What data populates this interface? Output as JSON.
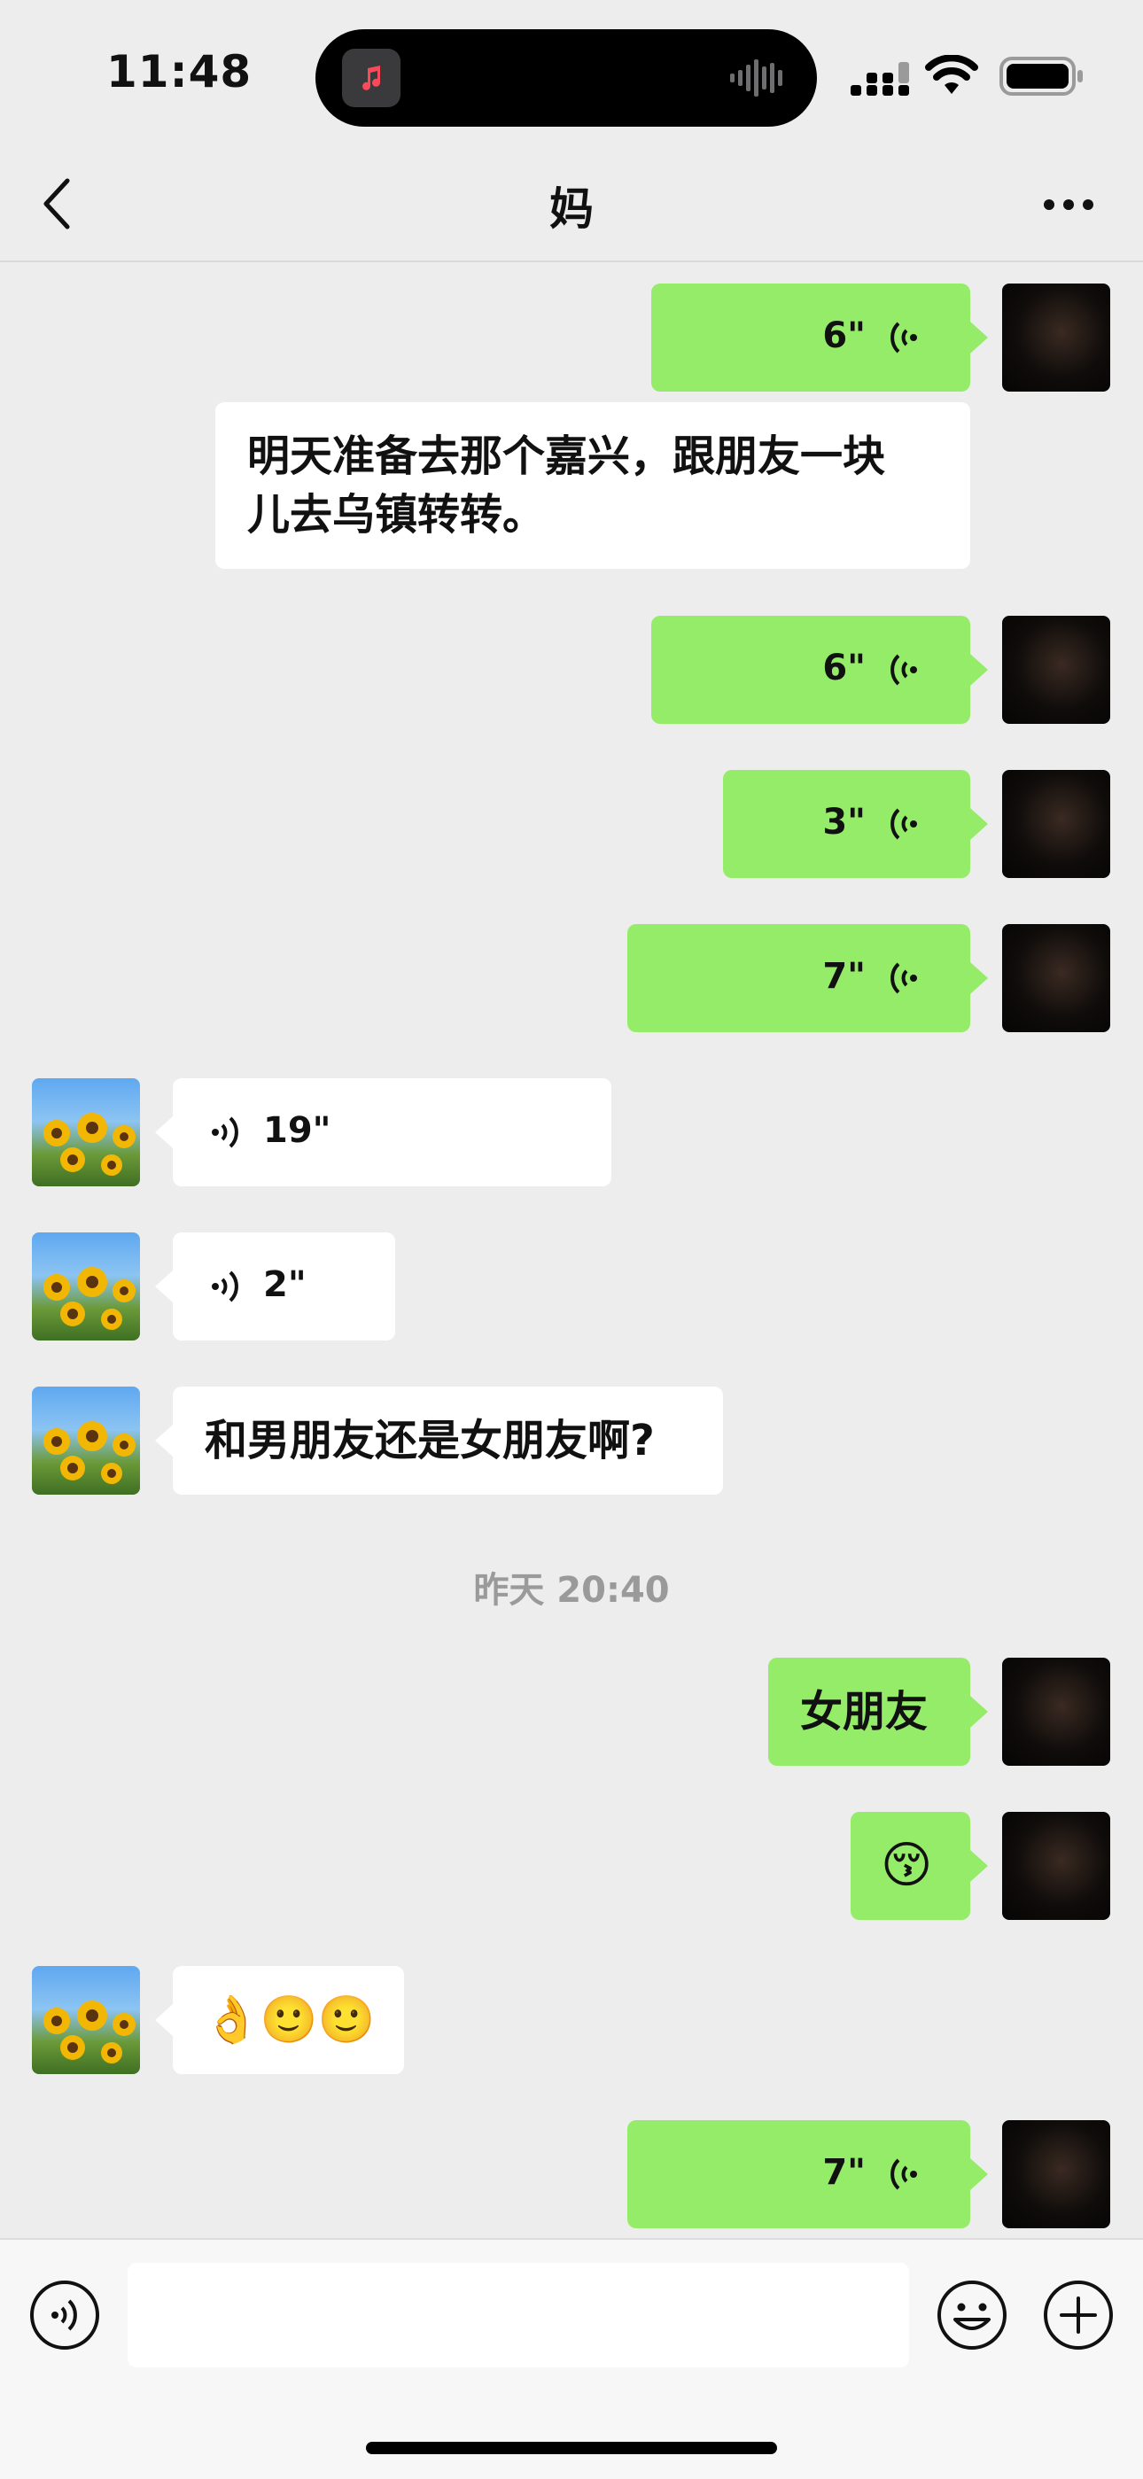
{
  "status_bar": {
    "time": "11:48"
  },
  "header": {
    "title": "妈"
  },
  "messages": [
    {
      "side": "out",
      "type": "voice",
      "duration": "6\""
    },
    {
      "side": "in_noavatar",
      "type": "text",
      "line1": "明天准备去那个嘉兴，跟朋友一块",
      "line2": "儿去乌镇转转。"
    },
    {
      "side": "out",
      "type": "voice",
      "duration": "6\""
    },
    {
      "side": "out",
      "type": "voice",
      "duration": "3\""
    },
    {
      "side": "out",
      "type": "voice",
      "duration": "7\""
    },
    {
      "side": "in",
      "type": "voice",
      "duration": "19\""
    },
    {
      "side": "in",
      "type": "voice",
      "duration": "2\""
    },
    {
      "side": "in",
      "type": "text",
      "text": "和男朋友还是女朋友啊?"
    },
    {
      "side": "out",
      "type": "text",
      "text": "女朋友"
    },
    {
      "side": "out",
      "type": "emoji",
      "text": "😚"
    },
    {
      "side": "in",
      "type": "emoji",
      "text": "👌🙂🙂"
    },
    {
      "side": "out",
      "type": "voice",
      "duration": "7\""
    }
  ],
  "timestamp": "昨天 20:40",
  "colors": {
    "outgoing": "#95ec69",
    "incoming": "#ffffff",
    "background": "#ededed"
  },
  "icons": [
    "back-icon",
    "more-icon",
    "voice-icon",
    "emoji-icon",
    "plus-icon"
  ]
}
